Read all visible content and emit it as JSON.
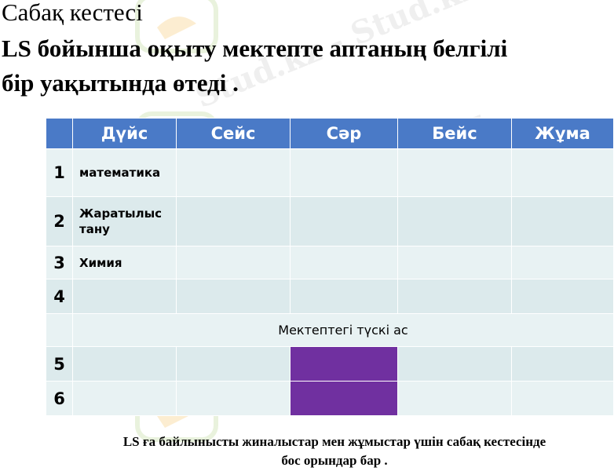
{
  "slide": {
    "subtitle": "Сабақ кестесі",
    "title_line1": "LS бойынша оқыту мектепте аптаның белгілі",
    "title_line2": "бір уақытында өтеді ."
  },
  "schedule": {
    "days": [
      "Дүйс",
      "Сейс",
      "Сәр",
      "Бейс",
      "Жұма"
    ],
    "rows": [
      {
        "num": "1",
        "subject": "математика"
      },
      {
        "num": "2",
        "subject": "Жаратылыс тану"
      },
      {
        "num": "3",
        "subject": "Химия"
      },
      {
        "num": "4",
        "subject": ""
      },
      {
        "lunch": "Мектептегі түскі ас"
      },
      {
        "num": "5",
        "subject": ""
      },
      {
        "num": "6",
        "subject": ""
      }
    ],
    "header_color": "#4a7ac7",
    "row_color": "#e8f2f3",
    "highlight_color": "#7030a0"
  },
  "footnote": {
    "line1": "LS ға байлынысты жиналыстар мен жұмыстар үшін сабақ кестесінде",
    "line2": "бос орындар бар ."
  },
  "watermark": {
    "text": "Stud.kz - Stud.kz",
    "logo_icon": "hummingbird-icon"
  }
}
